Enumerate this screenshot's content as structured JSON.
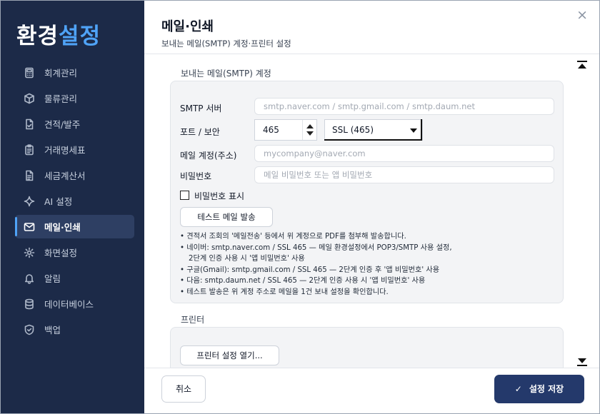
{
  "sidebar": {
    "title_part1": "환경",
    "title_part2": "설정",
    "items": [
      {
        "label": "회계관리",
        "icon": "calculator-icon"
      },
      {
        "label": "물류관리",
        "icon": "box-icon"
      },
      {
        "label": "견적/발주",
        "icon": "document-check-icon"
      },
      {
        "label": "거래명세표",
        "icon": "clipboard-icon"
      },
      {
        "label": "세금계산서",
        "icon": "document-icon"
      },
      {
        "label": "AI 설정",
        "icon": "sparkle-icon"
      },
      {
        "label": "메일·인쇄",
        "icon": "mail-icon",
        "active": true
      },
      {
        "label": "화면설정",
        "icon": "gear-icon"
      },
      {
        "label": "알림",
        "icon": "bell-icon"
      },
      {
        "label": "데이터베이스",
        "icon": "database-icon"
      },
      {
        "label": "백업",
        "icon": "shield-check-icon"
      }
    ]
  },
  "header": {
    "title": "메일·인쇄",
    "subtitle": "보내는 메일(SMTP) 계정·프린터 설정",
    "close_glyph": "×"
  },
  "smtp": {
    "section_title": "보내는 메일(SMTP) 계정",
    "server_label": "SMTP 서버",
    "server_placeholder": "smtp.naver.com / smtp.gmail.com / smtp.daum.net",
    "port_label": "포트 / 보안",
    "port_value": "465",
    "security_value": "SSL (465)",
    "account_label": "메일 계정(주소)",
    "account_placeholder": "mycompany@naver.com",
    "password_label": "비밀번호",
    "password_placeholder": "메일 비밀번호 또는 앱 비밀번호",
    "show_password_label": "비밀번호 표시",
    "show_password_checked": false,
    "test_button": "테스트 메일 발송",
    "notes": [
      "• 견적서 조회의 '메일전송' 등에서 위 계정으로 PDF를 첨부해 발송합니다.",
      "• 네이버: smtp.naver.com / SSL 465 — 메일 환경설정에서 POP3/SMTP 사용 설정,",
      "  2단계 인증 사용 시 '앱 비밀번호' 사용",
      "• 구글(Gmail): smtp.gmail.com / SSL 465 — 2단계 인증 후 '앱 비밀번호' 사용",
      "• 다음: smtp.daum.net / SSL 465 — 2단계 인증 사용 시 '앱 비밀번호' 사용",
      "• 테스트 발송은 위 계정 주소로 메일을 1건 보내 설정을 확인합니다."
    ]
  },
  "printer": {
    "section_title": "프린터",
    "open_settings_button": "프린터 설정 열기..."
  },
  "footer": {
    "cancel_label": "취소",
    "save_label": "설정 저장",
    "save_glyph": "✓"
  },
  "colors": {
    "sidebar_bg": "#1c2a48",
    "accent": "#4fa3f7",
    "primary_button": "#24396b"
  }
}
